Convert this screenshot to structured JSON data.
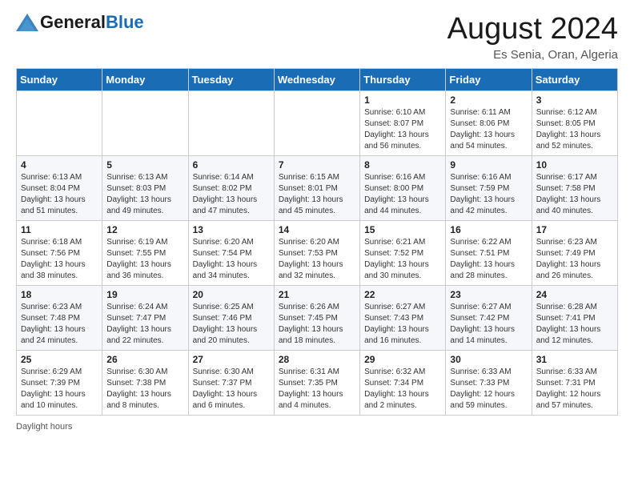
{
  "header": {
    "logo_general": "General",
    "logo_blue": "Blue",
    "month_title": "August 2024",
    "location": "Es Senia, Oran, Algeria"
  },
  "days_of_week": [
    "Sunday",
    "Monday",
    "Tuesday",
    "Wednesday",
    "Thursday",
    "Friday",
    "Saturday"
  ],
  "weeks": [
    [
      {
        "day": "",
        "info": ""
      },
      {
        "day": "",
        "info": ""
      },
      {
        "day": "",
        "info": ""
      },
      {
        "day": "",
        "info": ""
      },
      {
        "day": "1",
        "info": "Sunrise: 6:10 AM\nSunset: 8:07 PM\nDaylight: 13 hours and 56 minutes."
      },
      {
        "day": "2",
        "info": "Sunrise: 6:11 AM\nSunset: 8:06 PM\nDaylight: 13 hours and 54 minutes."
      },
      {
        "day": "3",
        "info": "Sunrise: 6:12 AM\nSunset: 8:05 PM\nDaylight: 13 hours and 52 minutes."
      }
    ],
    [
      {
        "day": "4",
        "info": "Sunrise: 6:13 AM\nSunset: 8:04 PM\nDaylight: 13 hours and 51 minutes."
      },
      {
        "day": "5",
        "info": "Sunrise: 6:13 AM\nSunset: 8:03 PM\nDaylight: 13 hours and 49 minutes."
      },
      {
        "day": "6",
        "info": "Sunrise: 6:14 AM\nSunset: 8:02 PM\nDaylight: 13 hours and 47 minutes."
      },
      {
        "day": "7",
        "info": "Sunrise: 6:15 AM\nSunset: 8:01 PM\nDaylight: 13 hours and 45 minutes."
      },
      {
        "day": "8",
        "info": "Sunrise: 6:16 AM\nSunset: 8:00 PM\nDaylight: 13 hours and 44 minutes."
      },
      {
        "day": "9",
        "info": "Sunrise: 6:16 AM\nSunset: 7:59 PM\nDaylight: 13 hours and 42 minutes."
      },
      {
        "day": "10",
        "info": "Sunrise: 6:17 AM\nSunset: 7:58 PM\nDaylight: 13 hours and 40 minutes."
      }
    ],
    [
      {
        "day": "11",
        "info": "Sunrise: 6:18 AM\nSunset: 7:56 PM\nDaylight: 13 hours and 38 minutes."
      },
      {
        "day": "12",
        "info": "Sunrise: 6:19 AM\nSunset: 7:55 PM\nDaylight: 13 hours and 36 minutes."
      },
      {
        "day": "13",
        "info": "Sunrise: 6:20 AM\nSunset: 7:54 PM\nDaylight: 13 hours and 34 minutes."
      },
      {
        "day": "14",
        "info": "Sunrise: 6:20 AM\nSunset: 7:53 PM\nDaylight: 13 hours and 32 minutes."
      },
      {
        "day": "15",
        "info": "Sunrise: 6:21 AM\nSunset: 7:52 PM\nDaylight: 13 hours and 30 minutes."
      },
      {
        "day": "16",
        "info": "Sunrise: 6:22 AM\nSunset: 7:51 PM\nDaylight: 13 hours and 28 minutes."
      },
      {
        "day": "17",
        "info": "Sunrise: 6:23 AM\nSunset: 7:49 PM\nDaylight: 13 hours and 26 minutes."
      }
    ],
    [
      {
        "day": "18",
        "info": "Sunrise: 6:23 AM\nSunset: 7:48 PM\nDaylight: 13 hours and 24 minutes."
      },
      {
        "day": "19",
        "info": "Sunrise: 6:24 AM\nSunset: 7:47 PM\nDaylight: 13 hours and 22 minutes."
      },
      {
        "day": "20",
        "info": "Sunrise: 6:25 AM\nSunset: 7:46 PM\nDaylight: 13 hours and 20 minutes."
      },
      {
        "day": "21",
        "info": "Sunrise: 6:26 AM\nSunset: 7:45 PM\nDaylight: 13 hours and 18 minutes."
      },
      {
        "day": "22",
        "info": "Sunrise: 6:27 AM\nSunset: 7:43 PM\nDaylight: 13 hours and 16 minutes."
      },
      {
        "day": "23",
        "info": "Sunrise: 6:27 AM\nSunset: 7:42 PM\nDaylight: 13 hours and 14 minutes."
      },
      {
        "day": "24",
        "info": "Sunrise: 6:28 AM\nSunset: 7:41 PM\nDaylight: 13 hours and 12 minutes."
      }
    ],
    [
      {
        "day": "25",
        "info": "Sunrise: 6:29 AM\nSunset: 7:39 PM\nDaylight: 13 hours and 10 minutes."
      },
      {
        "day": "26",
        "info": "Sunrise: 6:30 AM\nSunset: 7:38 PM\nDaylight: 13 hours and 8 minutes."
      },
      {
        "day": "27",
        "info": "Sunrise: 6:30 AM\nSunset: 7:37 PM\nDaylight: 13 hours and 6 minutes."
      },
      {
        "day": "28",
        "info": "Sunrise: 6:31 AM\nSunset: 7:35 PM\nDaylight: 13 hours and 4 minutes."
      },
      {
        "day": "29",
        "info": "Sunrise: 6:32 AM\nSunset: 7:34 PM\nDaylight: 13 hours and 2 minutes."
      },
      {
        "day": "30",
        "info": "Sunrise: 6:33 AM\nSunset: 7:33 PM\nDaylight: 12 hours and 59 minutes."
      },
      {
        "day": "31",
        "info": "Sunrise: 6:33 AM\nSunset: 7:31 PM\nDaylight: 12 hours and 57 minutes."
      }
    ]
  ],
  "footer": {
    "note": "Daylight hours"
  }
}
